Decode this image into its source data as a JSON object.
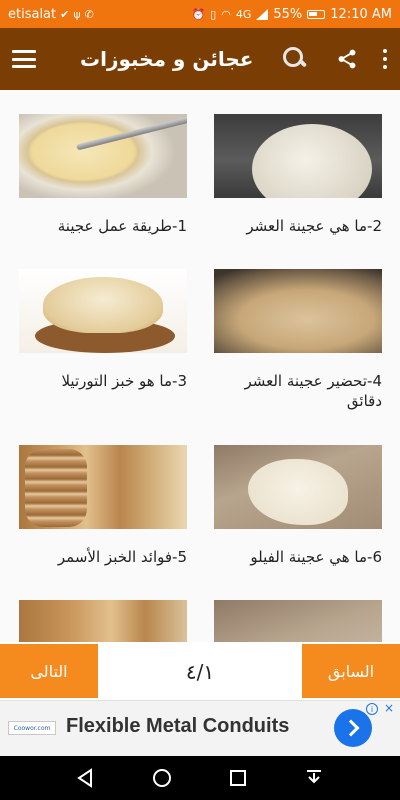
{
  "status_bar": {
    "carrier": "etisalat",
    "battery_percent": "55%",
    "time": "12:10 AM",
    "network_label": "4G"
  },
  "app_bar": {
    "title": "عجائن و مخبوزات"
  },
  "grid": [
    {
      "label": "2-ما هي عجينة العشر"
    },
    {
      "label": "1-طريقة عمل عجينة"
    },
    {
      "label": "4-تحضير عجينة العشر دقائق"
    },
    {
      "label": "3-ما هو خبز التورتيلا"
    },
    {
      "label": "6-ما هي عجينة الفيلو"
    },
    {
      "label": "5-فوائد الخبز الأسمر"
    }
  ],
  "pager": {
    "next_label": "التالى",
    "prev_label": "السابق",
    "indicator": "٤/١"
  },
  "ad": {
    "logo_text": "Coowor.com",
    "headline": "Flexible Metal Conduits",
    "info": "i",
    "close": "×"
  },
  "colors": {
    "status_bar": "#f0750f",
    "app_bar": "#7a3d04",
    "pager_button": "#f58a1f",
    "ad_button": "#1a73e8"
  }
}
